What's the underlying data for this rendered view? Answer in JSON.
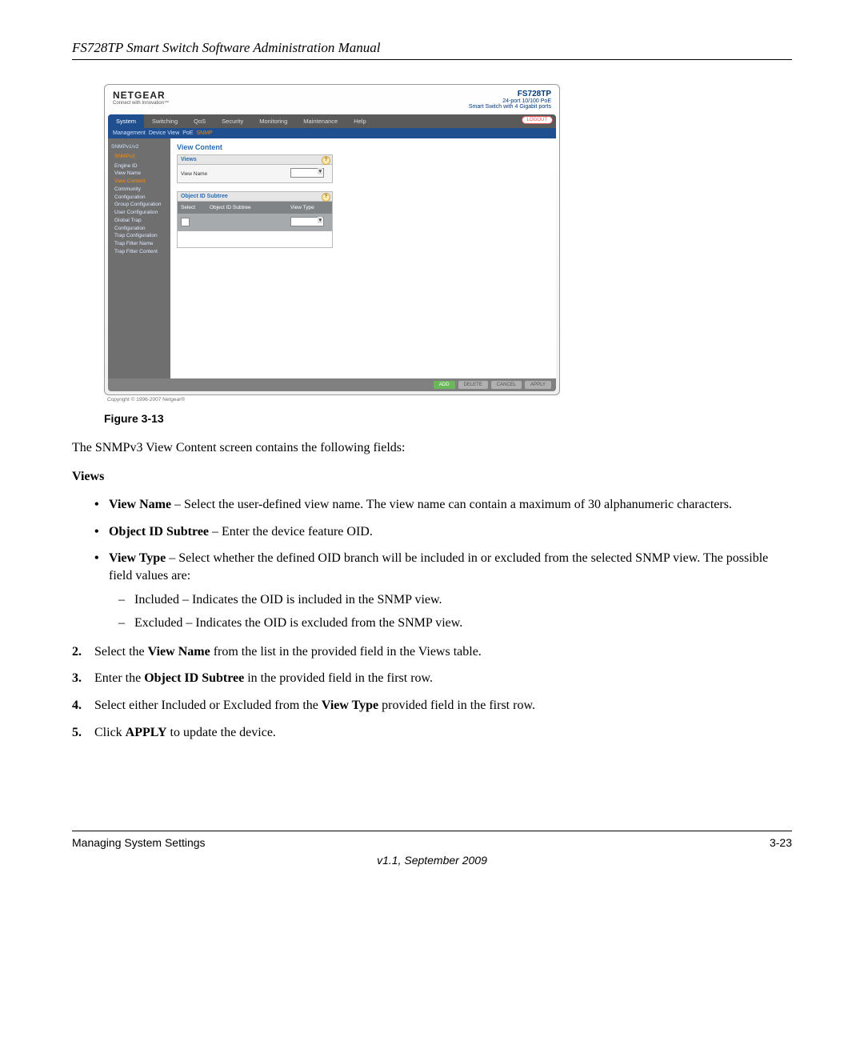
{
  "doc": {
    "header": "FS728TP Smart Switch Software Administration Manual",
    "figure_label": "Figure 3-13",
    "intro": "The SNMPv3 View Content screen contains the following fields:",
    "views_heading": "Views",
    "bullet1_label": "View Name",
    "bullet1_text": " – Select the user-defined view name. The view name can contain a maximum of 30 alphanumeric characters.",
    "bullet2_label": "Object ID Subtree",
    "bullet2_text": " – Enter the device feature OID.",
    "bullet3_label": "View Type",
    "bullet3_text": " – Select whether the defined OID branch will be included in or excluded from the selected SNMP view. The possible field values are:",
    "dash1": "Included – Indicates the OID is included in the SNMP view.",
    "dash2": "Excluded – Indicates the OID is excluded from the SNMP view.",
    "step2_num": "2.",
    "step2_a": "Select the ",
    "step2_b": "View Name",
    "step2_c": " from the list in the provided field in the Views table.",
    "step3_num": "3.",
    "step3_a": "Enter the ",
    "step3_b": "Object ID Subtree",
    "step3_c": " in the provided field in the first row.",
    "step4_num": "4.",
    "step4_a": "Select either Included or Excluded from the ",
    "step4_b": "View Type",
    "step4_c": " provided field in the first row.",
    "step5_num": "5.",
    "step5_a": "Click ",
    "step5_b": "APPLY",
    "step5_c": " to update the device.",
    "footer_left": "Managing System Settings",
    "footer_right": "3-23",
    "footer_version": "v1.1, September 2009"
  },
  "ui": {
    "brand": "NETGEAR",
    "tagline": "Connect with Innovation™",
    "model": "FS728TP",
    "model_sub1": "24-port 10/100 PoE",
    "model_sub2": "Smart Switch with 4 Gigabit ports",
    "tabs": [
      "System",
      "Switching",
      "QoS",
      "Security",
      "Monitoring",
      "Maintenance",
      "Help"
    ],
    "logout": "LOGOUT",
    "subtabs": [
      "Management",
      "Device View",
      "PoE",
      "SNMP"
    ],
    "side_group1": "SNMPv1/v2",
    "side_group2": "SNMPv3",
    "side_items": [
      "Engine ID",
      "View Name",
      "View Content",
      "Community Configuration",
      "Group Configuration",
      "User Configuration",
      "Global Trap Configuration",
      "Trap Configuration",
      "Trap Filter Name",
      "Trap Filter Content"
    ],
    "main_title": "View Content",
    "panel1_title": "Views",
    "panel1_field": "View Name",
    "panel2_title": "Object ID Subtree",
    "panel2_col1": "Select",
    "panel2_col2": "Object ID Subtree",
    "panel2_col3": "View Type",
    "buttons": {
      "add": "ADD",
      "delete": "DELETE",
      "cancel": "CANCEL",
      "apply": "APPLY"
    },
    "copyright": "Copyright © 1996-2007 Netgear®"
  }
}
